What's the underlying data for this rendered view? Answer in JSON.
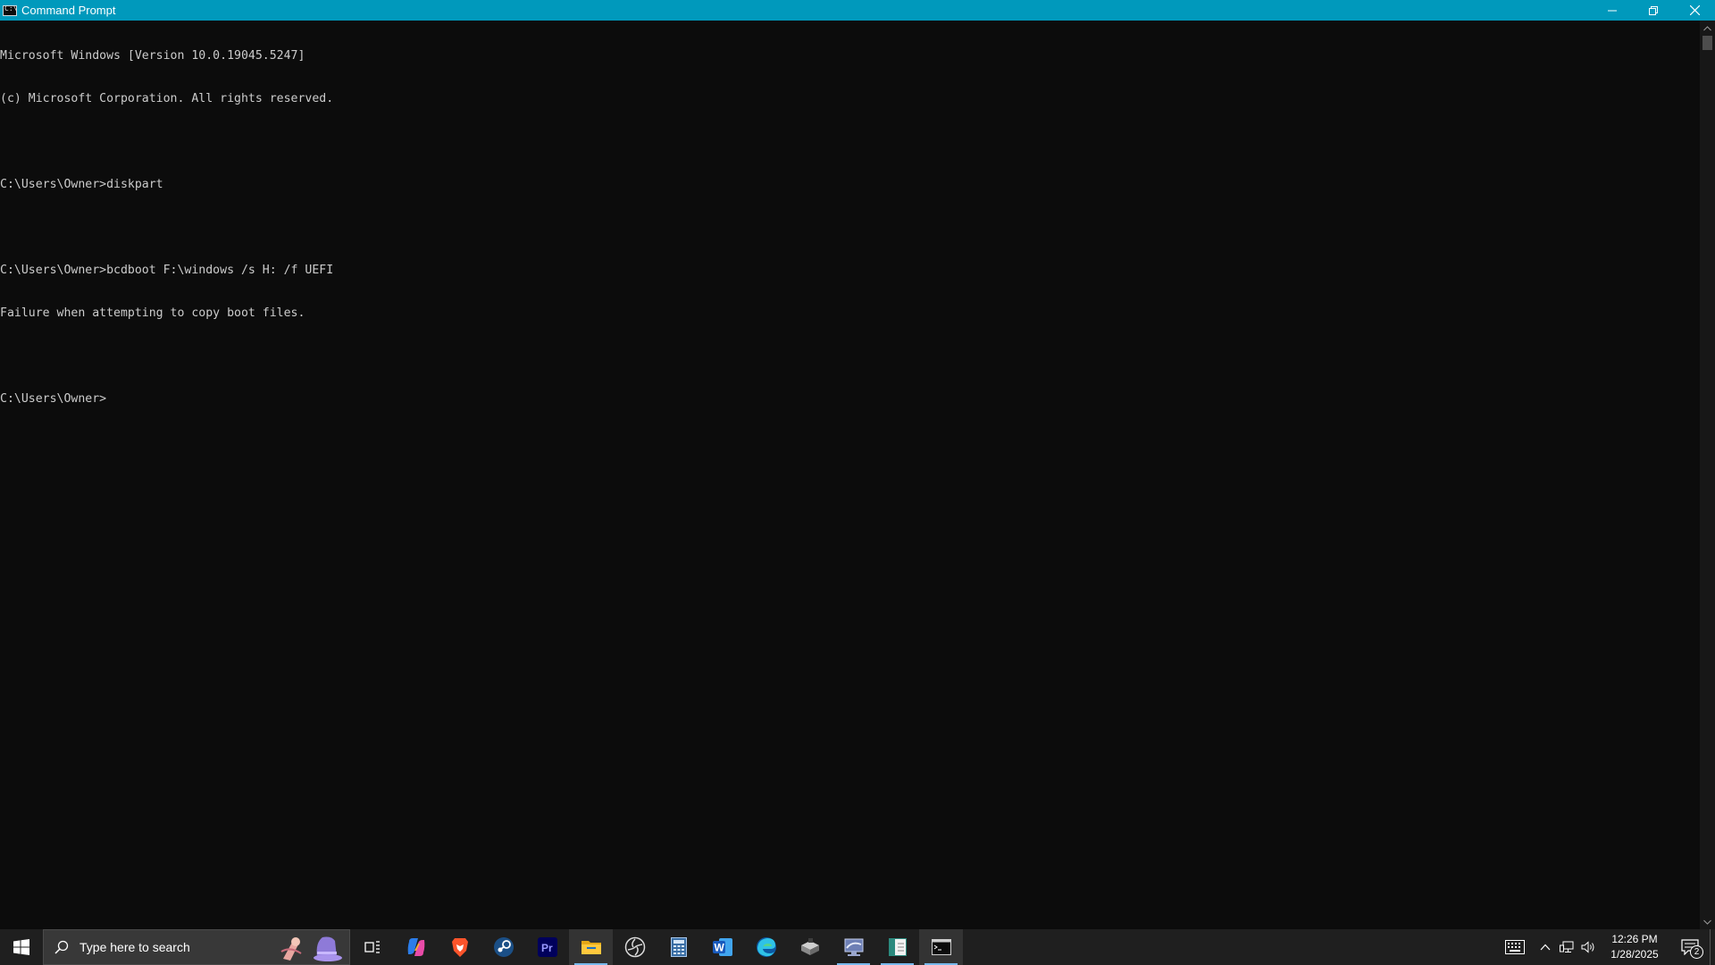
{
  "window": {
    "title": "Command Prompt",
    "controls": [
      "minimize",
      "restore",
      "close"
    ]
  },
  "console": {
    "lines": [
      "Microsoft Windows [Version 10.0.19045.5247]",
      "(c) Microsoft Corporation. All rights reserved.",
      "",
      "C:\\Users\\Owner>diskpart",
      "",
      "C:\\Users\\Owner>bcdboot F:\\windows /s H: /f UEFI",
      "Failure when attempting to copy boot files.",
      "",
      "C:\\Users\\Owner>"
    ]
  },
  "taskbar": {
    "search_placeholder": "Type here to search",
    "apps": [
      {
        "name": "task-view-icon",
        "active": false
      },
      {
        "name": "copilot-icon",
        "active": false
      },
      {
        "name": "brave-icon",
        "active": false
      },
      {
        "name": "steam-icon",
        "active": false
      },
      {
        "name": "premiere-pro-icon",
        "active": false
      },
      {
        "name": "file-explorer-icon",
        "active": false
      },
      {
        "name": "obs-icon",
        "active": false
      },
      {
        "name": "calculator-icon",
        "active": false
      },
      {
        "name": "word-icon",
        "active": false
      },
      {
        "name": "edge-icon",
        "active": false
      },
      {
        "name": "installer-icon",
        "active": false
      },
      {
        "name": "remote-desktop-icon",
        "active": false
      },
      {
        "name": "notepad-app-icon",
        "active": false
      },
      {
        "name": "command-prompt-icon",
        "active": true
      }
    ],
    "premiere_label": "Pr",
    "word_label": "W",
    "clock": {
      "time": "12:26 PM",
      "date": "1/28/2025"
    },
    "notification_count": "2"
  },
  "colors": {
    "titlebar": "#0099bc",
    "console_bg": "#0c0c0c",
    "console_text": "#cccccc",
    "taskbar_bg": "#1f1f1f",
    "active_indicator": "#76b9ed"
  }
}
